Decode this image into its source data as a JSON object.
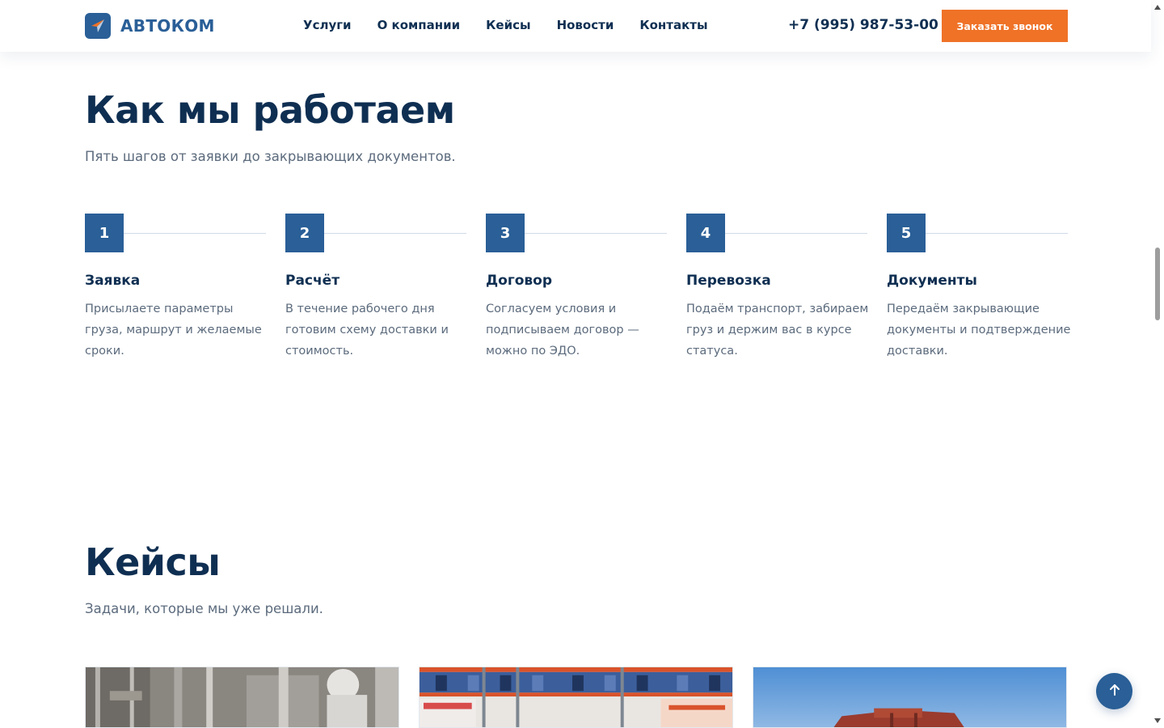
{
  "header": {
    "brand": "АВТОКОМ",
    "nav": [
      "Услуги",
      "О компании",
      "Кейсы",
      "Новости",
      "Контакты"
    ],
    "phone": "+7 (995) 987-53-00",
    "cta": "Заказать звонок"
  },
  "how_we_work": {
    "title": "Как мы работаем",
    "subtitle": "Пять шагов от заявки до закрывающих документов.",
    "steps": [
      {
        "num": "1",
        "title": "Заявка",
        "text": "Присылаете параметры груза, маршрут и желаемые сроки."
      },
      {
        "num": "2",
        "title": "Расчёт",
        "text": "В течение рабочего дня готовим схему доставки и стоимость."
      },
      {
        "num": "3",
        "title": "Договор",
        "text": "Согласуем условия и подписываем договор — можно по ЭДО."
      },
      {
        "num": "4",
        "title": "Перевозка",
        "text": "Подаём транспорт, забираем груз и держим вас в курсе статуса."
      },
      {
        "num": "5",
        "title": "Документы",
        "text": "Передаём закрывающие документы и подтверждение доставки."
      }
    ]
  },
  "cases": {
    "title": "Кейсы",
    "subtitle": "Задачи, которые мы уже решали."
  },
  "colors": {
    "primary": "#2a5f97",
    "accent": "#ef7227",
    "heading": "#0f2f52",
    "muted": "#5c6b7d"
  },
  "icons": {
    "logo": "logo-arrow-icon",
    "back_to_top": "arrow-up-icon"
  }
}
